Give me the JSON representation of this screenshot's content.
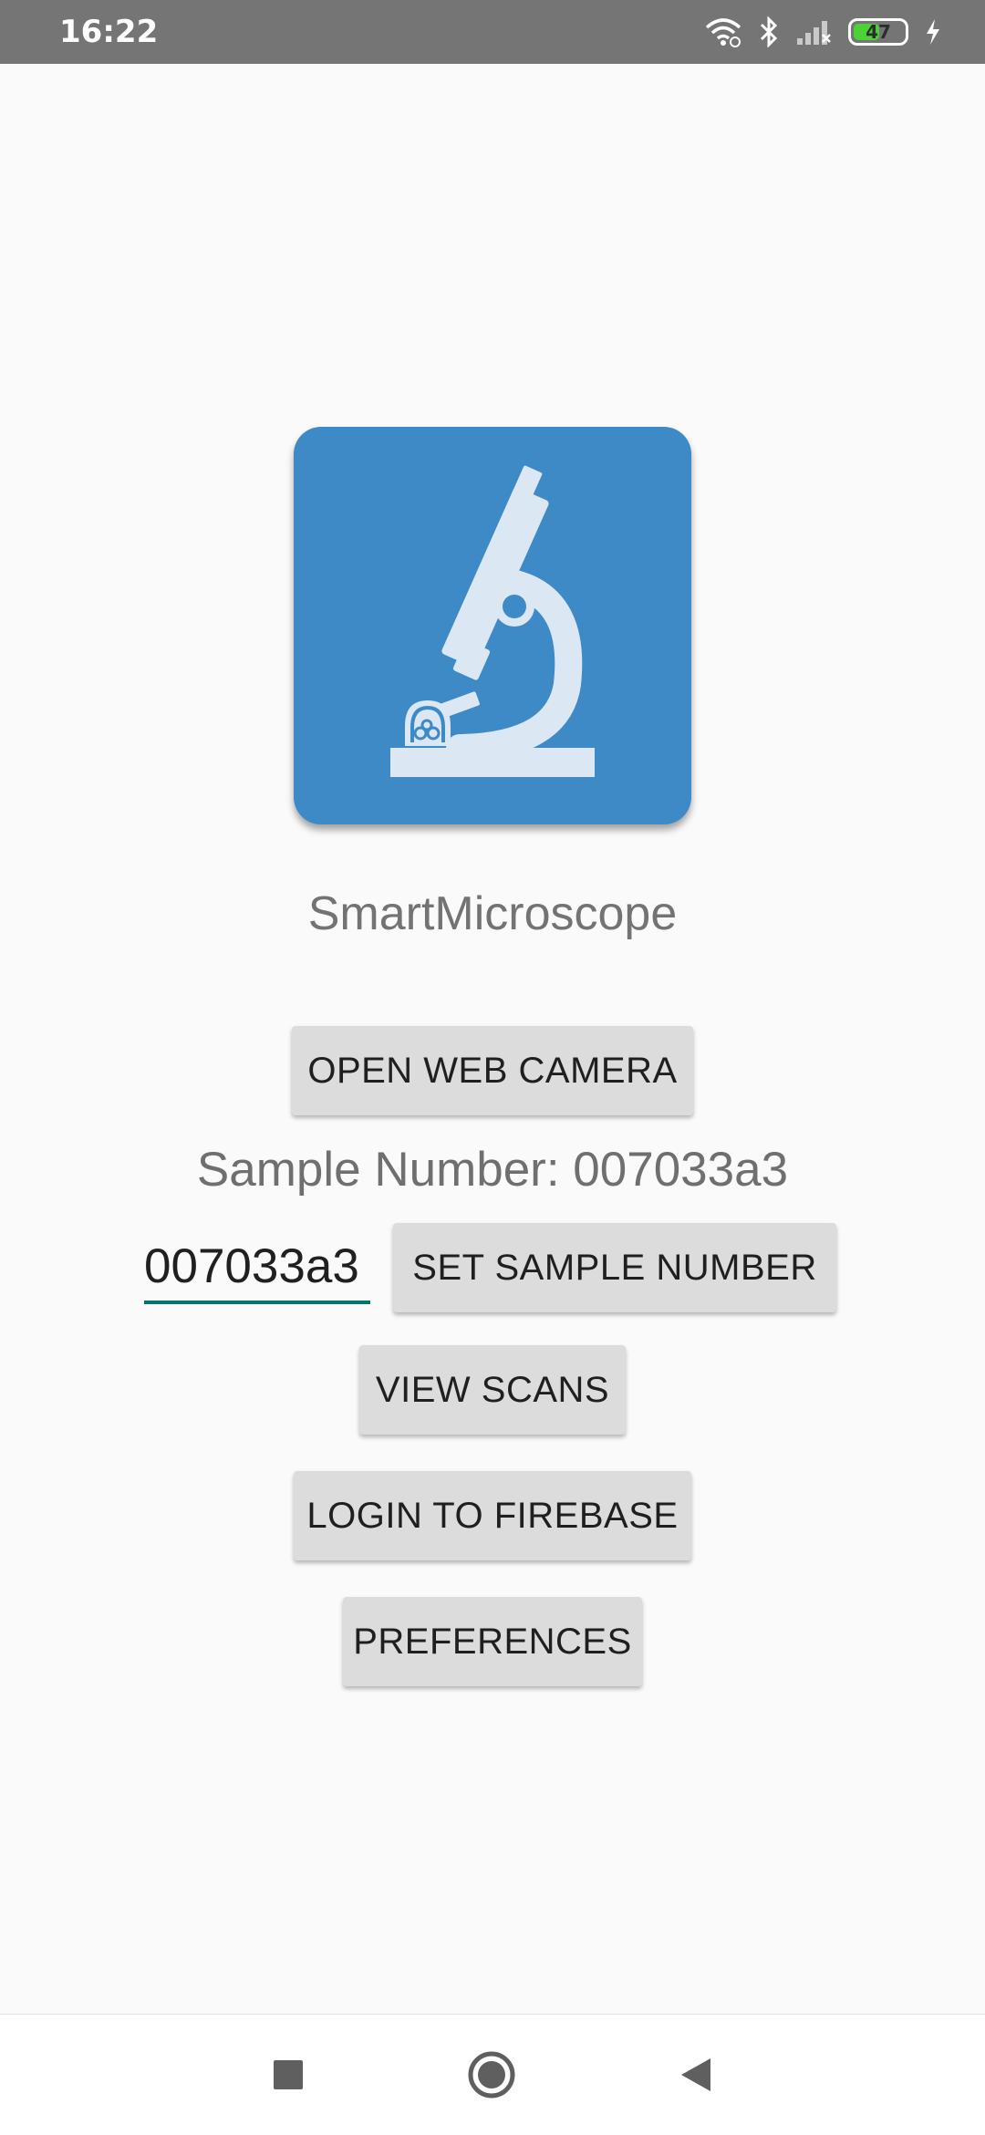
{
  "status_bar": {
    "time": "16:22",
    "battery_level": "47",
    "icons": [
      "wifi-icon",
      "bluetooth-icon",
      "signal-icon",
      "battery-icon",
      "charging-icon"
    ]
  },
  "app": {
    "title": "SmartMicroscope",
    "logo_icon": "microscope-icon",
    "colors": {
      "logo_background": "#3e8ac6",
      "logo_glyph": "#dbe8f4",
      "input_underline": "#00796b",
      "button_background": "#dcdcdc"
    }
  },
  "buttons": {
    "open_web_camera": "OPEN WEB CAMERA",
    "set_sample_number": "SET SAMPLE NUMBER",
    "view_scans": "VIEW SCANS",
    "login_to_firebase": "LOGIN TO FIREBASE",
    "preferences": "PREFERENCES"
  },
  "sample": {
    "label": "Sample Number: 007033a3",
    "input_value": "007033a3"
  },
  "nav_bar": {
    "icons": [
      "recents-square-icon",
      "home-circle-icon",
      "back-triangle-icon"
    ]
  }
}
